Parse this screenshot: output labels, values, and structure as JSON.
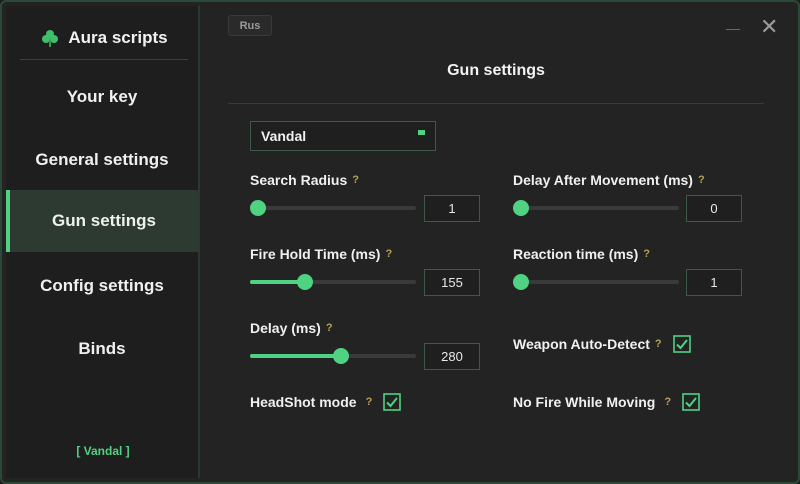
{
  "app": {
    "title": "Aura scripts"
  },
  "sidebar": {
    "items": [
      {
        "label": "Your key"
      },
      {
        "label": "General settings"
      },
      {
        "label": "Gun settings"
      },
      {
        "label": "Config settings"
      },
      {
        "label": "Binds"
      }
    ],
    "footer": "[ Vandal ]"
  },
  "header": {
    "lang_label": "Rus",
    "close_glyph": "✕"
  },
  "page": {
    "title": "Gun settings"
  },
  "weapon_select": {
    "value": "Vandal"
  },
  "settings": {
    "search_radius": {
      "label": "Search Radius",
      "help": "?",
      "value": "1",
      "fraction": 0.0
    },
    "delay_after_movement": {
      "label": "Delay After Movement (ms)",
      "help": "?",
      "value": "0",
      "fraction": 0.0
    },
    "fire_hold_time": {
      "label": "Fire Hold Time (ms)",
      "help": "?",
      "value": "155",
      "fraction": 0.33
    },
    "reaction_time": {
      "label": "Reaction time (ms)",
      "help": "?",
      "value": "1",
      "fraction": 0.0
    },
    "delay": {
      "label": "Delay (ms)",
      "help": "?",
      "value": "280",
      "fraction": 0.55
    },
    "weapon_auto_detect": {
      "label": "Weapon Auto-Detect",
      "help": "?",
      "checked": true
    },
    "headshot_mode": {
      "label": "HeadShot mode",
      "help": "?",
      "checked": true
    },
    "no_fire_while_moving": {
      "label": "No Fire While Moving",
      "help": "?",
      "checked": true
    }
  },
  "colors": {
    "accent": "#4fd282",
    "help": "#b7a055",
    "background": "#232323",
    "sidebar": "#1e1e1e"
  }
}
